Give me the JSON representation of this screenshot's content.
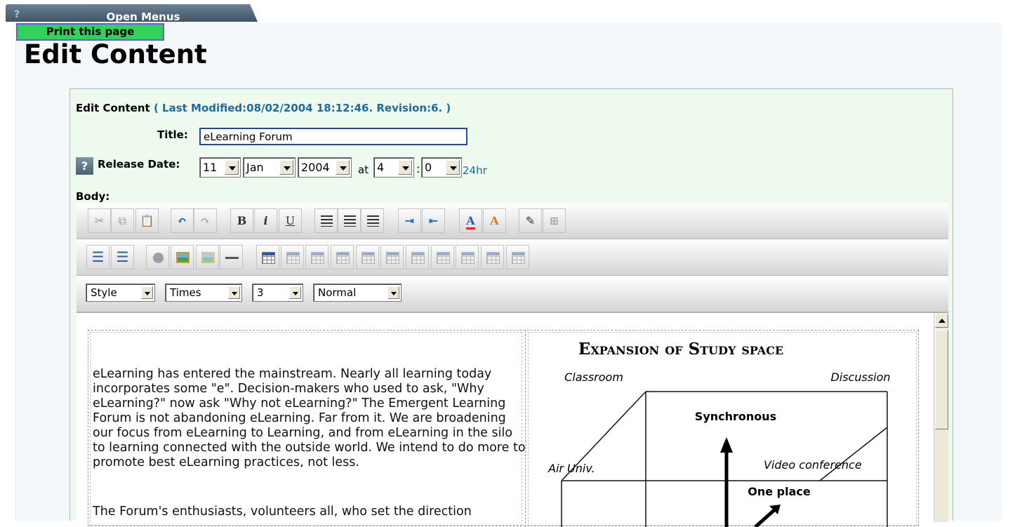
{
  "menu": {
    "help_glyph": "?",
    "open_menus_label": "Open Menus"
  },
  "print_button_label": "Print this page",
  "page_title": "Edit Content",
  "editor": {
    "heading_label": "Edit Content",
    "modified_text": "( Last Modified:08/02/2004 18:12:46. Revision:6. )",
    "title_label": "Title:",
    "title_value": "eLearning Forum",
    "help_glyph": "?",
    "release_label": "Release Date:",
    "release": {
      "day": "11",
      "month": "Jan",
      "year": "2004",
      "at_label": "at",
      "hour": "4",
      "colon": ":",
      "minute": "0",
      "clock_label": "24hr"
    },
    "body_label": "Body:"
  },
  "toolbar_row1": [
    {
      "name": "cut-button",
      "glyph": "✂",
      "style": "dim"
    },
    {
      "name": "copy-button",
      "glyph": "⧉",
      "style": "dim"
    },
    {
      "name": "paste-button",
      "glyph": "📋",
      "style": "dim"
    },
    {
      "name": "undo-button",
      "glyph": "↶",
      "style": "blue"
    },
    {
      "name": "redo-button",
      "glyph": "↷",
      "style": "dim"
    },
    {
      "name": "bold-button",
      "glyph": "B",
      "style": "bold"
    },
    {
      "name": "italic-button",
      "glyph": "i",
      "style": "italic"
    },
    {
      "name": "underline-button",
      "glyph": "U",
      "style": "underline"
    },
    {
      "name": "align-left-button",
      "glyph": "",
      "style": "lines"
    },
    {
      "name": "align-center-button",
      "glyph": "",
      "style": "lines"
    },
    {
      "name": "align-right-button",
      "glyph": "",
      "style": "lines"
    },
    {
      "name": "indent-button",
      "glyph": "⇥",
      "style": "blue"
    },
    {
      "name": "outdent-button",
      "glyph": "⇤",
      "style": "blue"
    },
    {
      "name": "text-color-button",
      "glyph": "A",
      "style": "color"
    },
    {
      "name": "highlight-color-button",
      "glyph": "A",
      "style": "color2"
    },
    {
      "name": "edit-source-button",
      "glyph": "✎",
      "style": ""
    },
    {
      "name": "toggle-borders-button",
      "glyph": "⊞",
      "style": "dim"
    }
  ],
  "toolbar_row2": [
    {
      "name": "ordered-list-button",
      "glyph": "☰"
    },
    {
      "name": "unordered-list-button",
      "glyph": "☰"
    },
    {
      "name": "insert-link-button",
      "glyph": ""
    },
    {
      "name": "insert-image-button",
      "glyph": ""
    },
    {
      "name": "insert-media-button",
      "glyph": ""
    },
    {
      "name": "horizontal-rule-button",
      "glyph": ""
    },
    {
      "name": "insert-table-button",
      "glyph": ""
    },
    {
      "name": "table-properties-button",
      "glyph": ""
    },
    {
      "name": "cell-properties-button",
      "glyph": ""
    },
    {
      "name": "insert-row-button",
      "glyph": ""
    },
    {
      "name": "insert-column-button",
      "glyph": ""
    },
    {
      "name": "delete-row-button",
      "glyph": ""
    },
    {
      "name": "delete-column-button",
      "glyph": ""
    },
    {
      "name": "merge-cells-button",
      "glyph": ""
    },
    {
      "name": "split-cell-button",
      "glyph": ""
    },
    {
      "name": "insert-cell-button",
      "glyph": ""
    },
    {
      "name": "delete-cell-button",
      "glyph": ""
    }
  ],
  "format_bar": {
    "style": "Style",
    "font": "Times",
    "size": "3",
    "block": "Normal"
  },
  "content": {
    "paragraph1": "eLearning has entered the mainstream. Nearly all learning today incorporates some \"e\". Decision-makers who used to ask, \"Why eLearning?\" now ask \"Why not eLearning?\" The Emergent Learning Forum is not abandoning eLearning. Far from it. We are broadening our focus from eLearning to Learning, and from eLearning in the silo to learning connected with the outside world. We intend to do more to promote best eLearning practices, not less.",
    "paragraph2": "The Forum's enthusiasts, volunteers all, who set the direction",
    "diagram": {
      "title": "Expansion of Study space",
      "labels": {
        "classroom": "Classroom",
        "discussion": "Discussion",
        "air_univ": "Air Univ.",
        "video_conference": "Video conference",
        "synchronous": "Synchronous",
        "one_place": "One place"
      }
    }
  }
}
